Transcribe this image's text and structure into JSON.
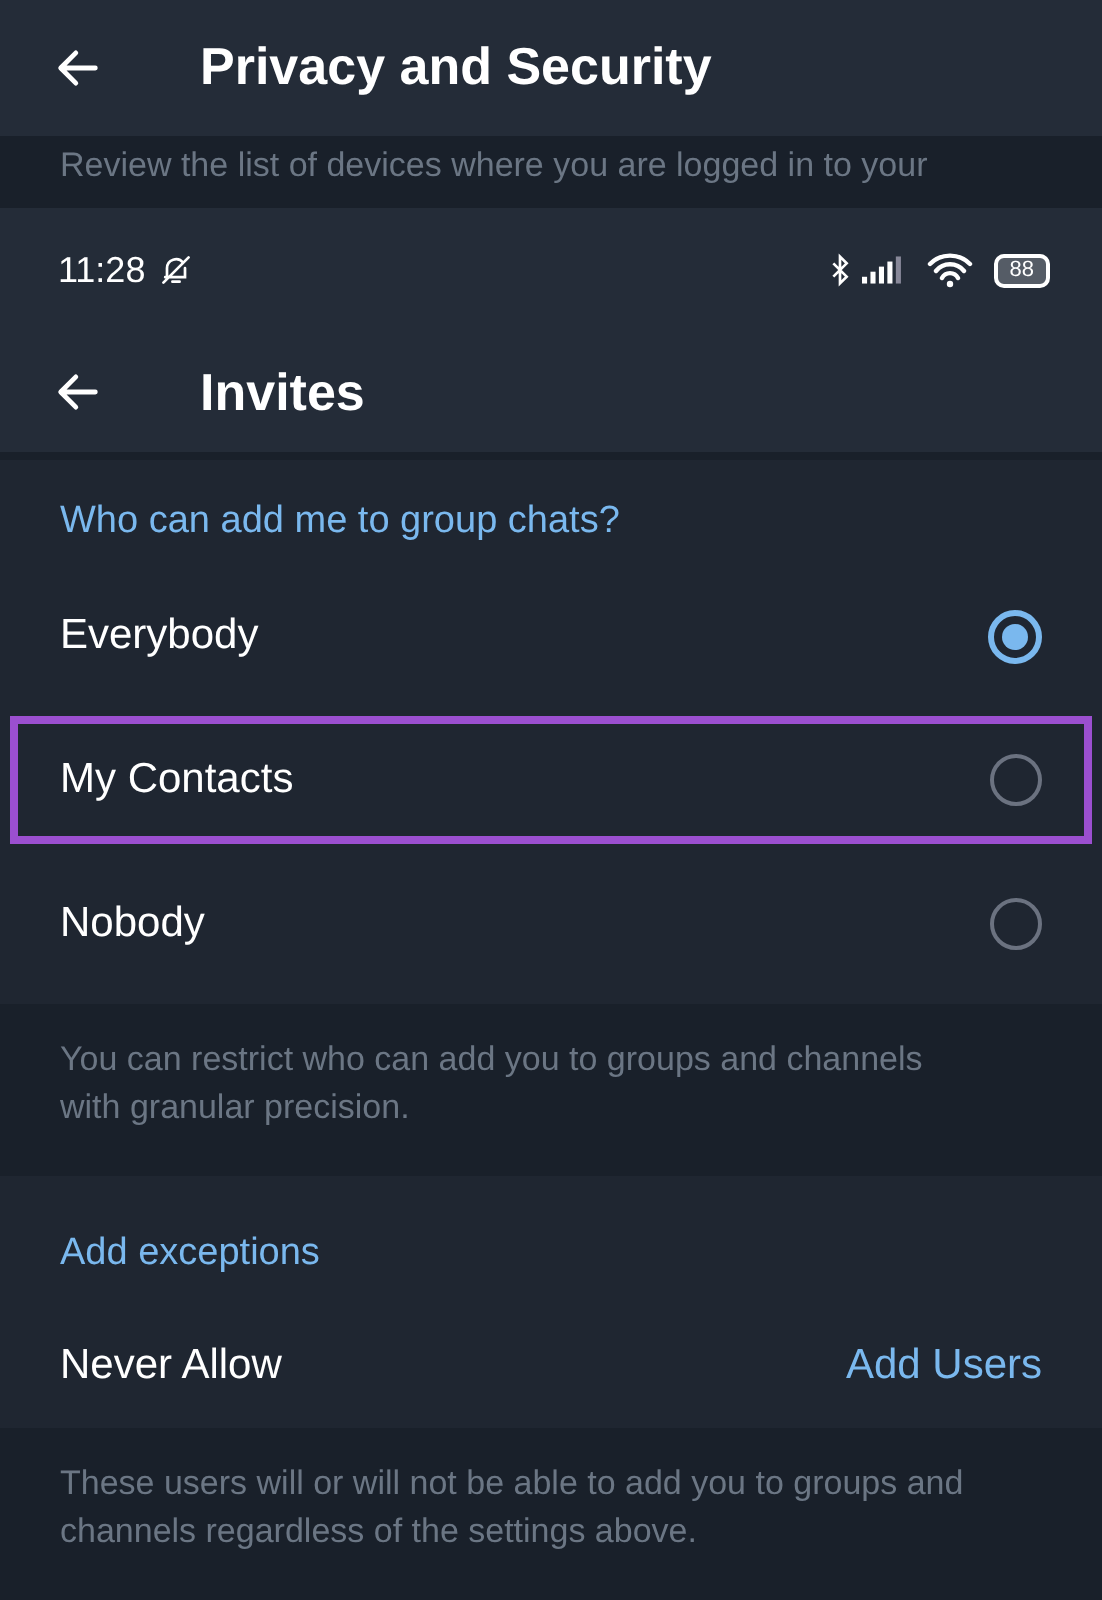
{
  "background_screen": {
    "title": "Privacy and Security",
    "info_lines": [
      "Review the list of devices where you are logged in to your"
    ]
  },
  "status_bar": {
    "time": "11:28",
    "battery": "88"
  },
  "header": {
    "title": "Invites"
  },
  "group_section": {
    "title": "Who can add me to group chats?",
    "options": [
      {
        "label": "Everybody",
        "selected": true,
        "highlighted": false
      },
      {
        "label": "My Contacts",
        "selected": false,
        "highlighted": true
      },
      {
        "label": "Nobody",
        "selected": false,
        "highlighted": false
      }
    ],
    "footer": "You can restrict who can add you to groups and channels with granular precision."
  },
  "exceptions_section": {
    "title": "Add exceptions",
    "rows": [
      {
        "label": "Never Allow",
        "action": "Add Users"
      }
    ],
    "footer": "These users will or will not be able to add you to groups and channels regardless of the settings above."
  }
}
